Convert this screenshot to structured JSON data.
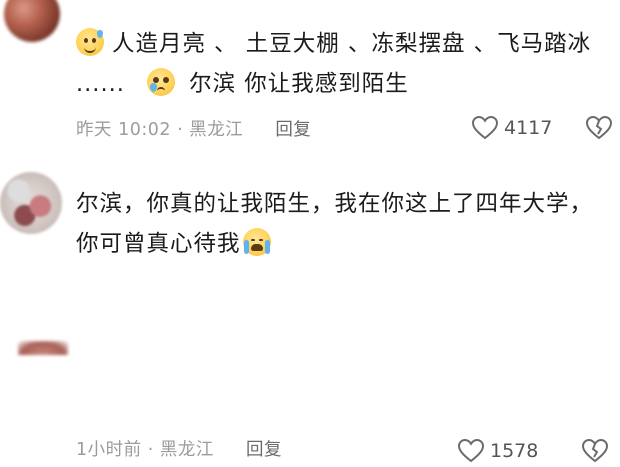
{
  "comments": [
    {
      "text_part1": "人造月亮 、 土豆大棚 、冻梨摆盘 、飞马踏冰 ......",
      "text_part2": "尔滨 你让我感到陌生",
      "emoji_start": "grinning-sweat-emoji",
      "emoji_mid": "pleading-tear-emoji",
      "time": "昨天 10:02",
      "location": "黑龙江",
      "reply_label": "回复",
      "likes": "4117"
    },
    {
      "text_part1": "尔滨，你真的让我陌生，我在你这上了四年大学，你可曾真心待我",
      "emoji_end": "loudly-crying-emoji",
      "time": "1小时前",
      "location": "黑龙江",
      "reply_label": "回复",
      "likes": "1578"
    }
  ],
  "colors": {
    "text": "#1b1b1b",
    "meta": "#9c9c9c",
    "icon": "#6b6b6b"
  }
}
